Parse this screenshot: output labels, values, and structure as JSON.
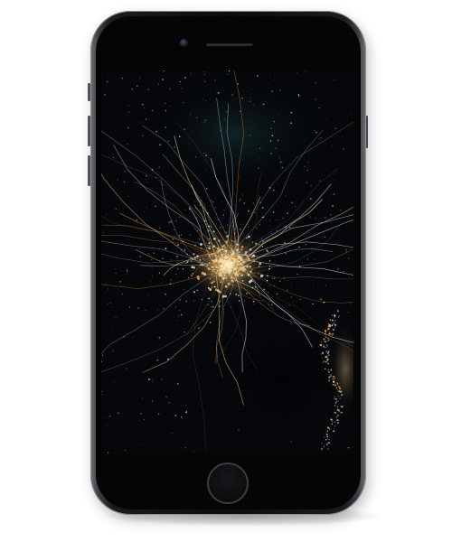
{
  "device": {
    "model": "smartphone",
    "finish": "space gray",
    "body_color": "#0c0c0e",
    "bezel_color": "#050506",
    "edge_color": "#6e7176"
  },
  "screen": {
    "content": "wallpaper",
    "wallpaper": "night-city-lights",
    "background_color": "#05070b",
    "light_colors": [
      "#ffd98a",
      "#ff9d3a",
      "#e9f2ff",
      "#bfe3ff"
    ],
    "haze_color": "#1b3a3a"
  },
  "icons": {
    "camera": "front-camera-icon",
    "speaker": "earpiece-icon",
    "home": "home-button-icon"
  }
}
